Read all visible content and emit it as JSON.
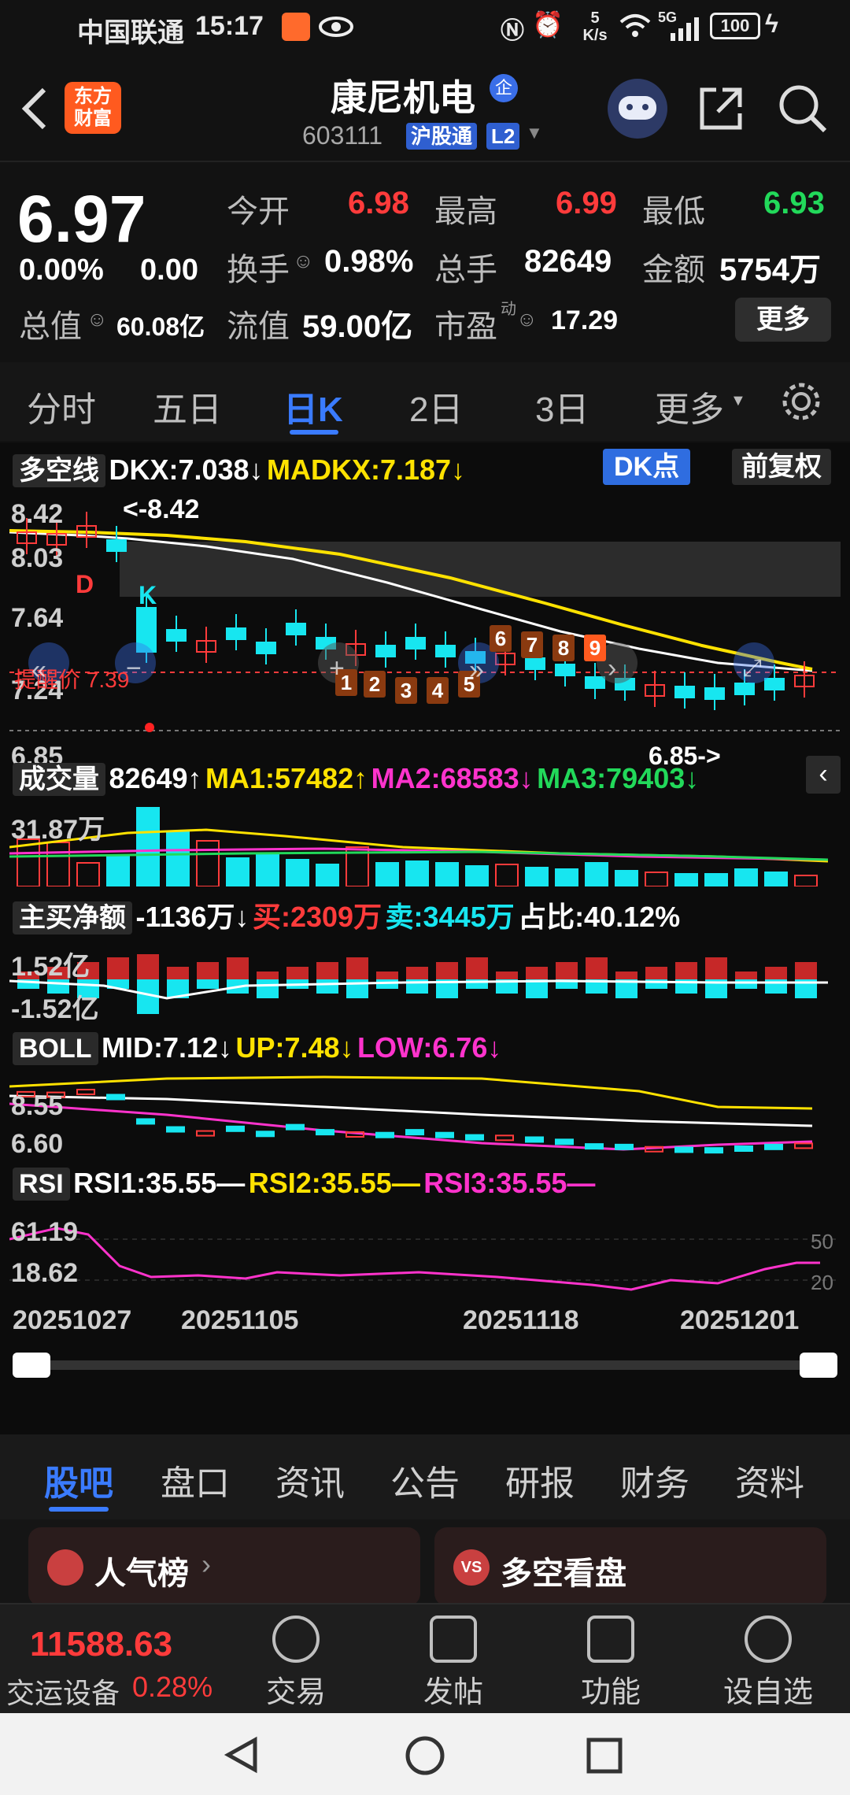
{
  "status_bar": {
    "carrier": "中国联通",
    "time": "15:17",
    "speed_num": "5",
    "speed_unit": "K/s",
    "net_type": "5G",
    "battery": "100"
  },
  "header": {
    "logo_line1": "东方",
    "logo_line2": "财富",
    "stock_name": "康尼机电",
    "enterprise_badge": "企",
    "stock_code": "603111",
    "exchange_tag": "沪股通",
    "level_tag": "L2"
  },
  "quote": {
    "price": "6.97",
    "change_pct": "0.00%",
    "change_amt": "0.00",
    "open_label": "今开",
    "open_value": "6.98",
    "high_label": "最高",
    "high_value": "6.99",
    "low_label": "最低",
    "low_value": "6.93",
    "turnover_label": "换手",
    "turnover_value": "0.98%",
    "volume_label": "总手",
    "volume_value": "82649",
    "amount_label": "金额",
    "amount_value": "5754万",
    "mktcap_label": "总值",
    "mktcap_value": "60.08亿",
    "float_label": "流值",
    "float_value": "59.00亿",
    "pe_label": "市盈",
    "pe_sup": "动",
    "pe_value": "17.29",
    "more_button": "更多"
  },
  "period_tabs": [
    "分时",
    "五日",
    "日K",
    "2日",
    "3日",
    "更多"
  ],
  "active_period": "日K",
  "chart": {
    "dk": {
      "name": "多空线",
      "dkx": "DKX:7.038↓",
      "madkx": "MADKX:7.187↓",
      "dk_button": "DK点",
      "adjust_button": "前复权",
      "y_labels": [
        "8.42",
        "8.03",
        "7.64",
        "7.24",
        "6.85"
      ],
      "high_marker": "<-8.42",
      "low_marker": "6.85->",
      "alert_price": "提醒价 7.39",
      "marker_d": "D",
      "marker_k": "K",
      "td_counts": [
        "1",
        "2",
        "3",
        "4",
        "5",
        "6",
        "7",
        "8",
        "9"
      ]
    },
    "volume": {
      "name": "成交量",
      "value": "82649↑",
      "ma1": "MA1:57482↑",
      "ma2": "MA2:68583↓",
      "ma3": "MA3:79403↓",
      "y_label": "31.87万"
    },
    "netbuy": {
      "name": "主买净额",
      "value": "-1136万↓",
      "buy": "买:2309万",
      "sell": "卖:3445万",
      "ratio": "占比:40.12%",
      "y_top": "1.52亿",
      "y_bottom": "-1.52亿"
    },
    "boll": {
      "name": "BOLL",
      "mid": "MID:7.12↓",
      "up": "UP:7.48↓",
      "low": "LOW:6.76↓",
      "y_top": "8.55",
      "y_bottom": "6.60"
    },
    "rsi": {
      "name": "RSI",
      "rsi1": "RSI1:35.55—",
      "rsi2": "RSI2:35.55—",
      "rsi3": "RSI3:35.55—",
      "y_top": "61.19",
      "y_bottom": "18.62",
      "ref_high": "50",
      "ref_low": "20"
    },
    "dates": [
      "20251027",
      "20251105",
      "20251118",
      "20251201"
    ]
  },
  "sub_tabs": [
    "股吧",
    "盘口",
    "资讯",
    "公告",
    "研报",
    "财务",
    "资料"
  ],
  "active_sub_tab": "股吧",
  "cards": {
    "popular": "人气榜",
    "bullbear": "多空看盘"
  },
  "bottom_bar": {
    "index_value": "11588.63",
    "index_name": "交运设备",
    "index_change": "0.28%",
    "trade": "交易",
    "post": "发帖",
    "function": "功能",
    "watchlist": "设自选"
  },
  "colors": {
    "up": "#ff3b3b",
    "down": "#17e6f0",
    "green": "#22d95a",
    "accent_blue": "#3a7bff",
    "dkx_line": "#ffffff",
    "madkx_line": "#ffe200"
  }
}
